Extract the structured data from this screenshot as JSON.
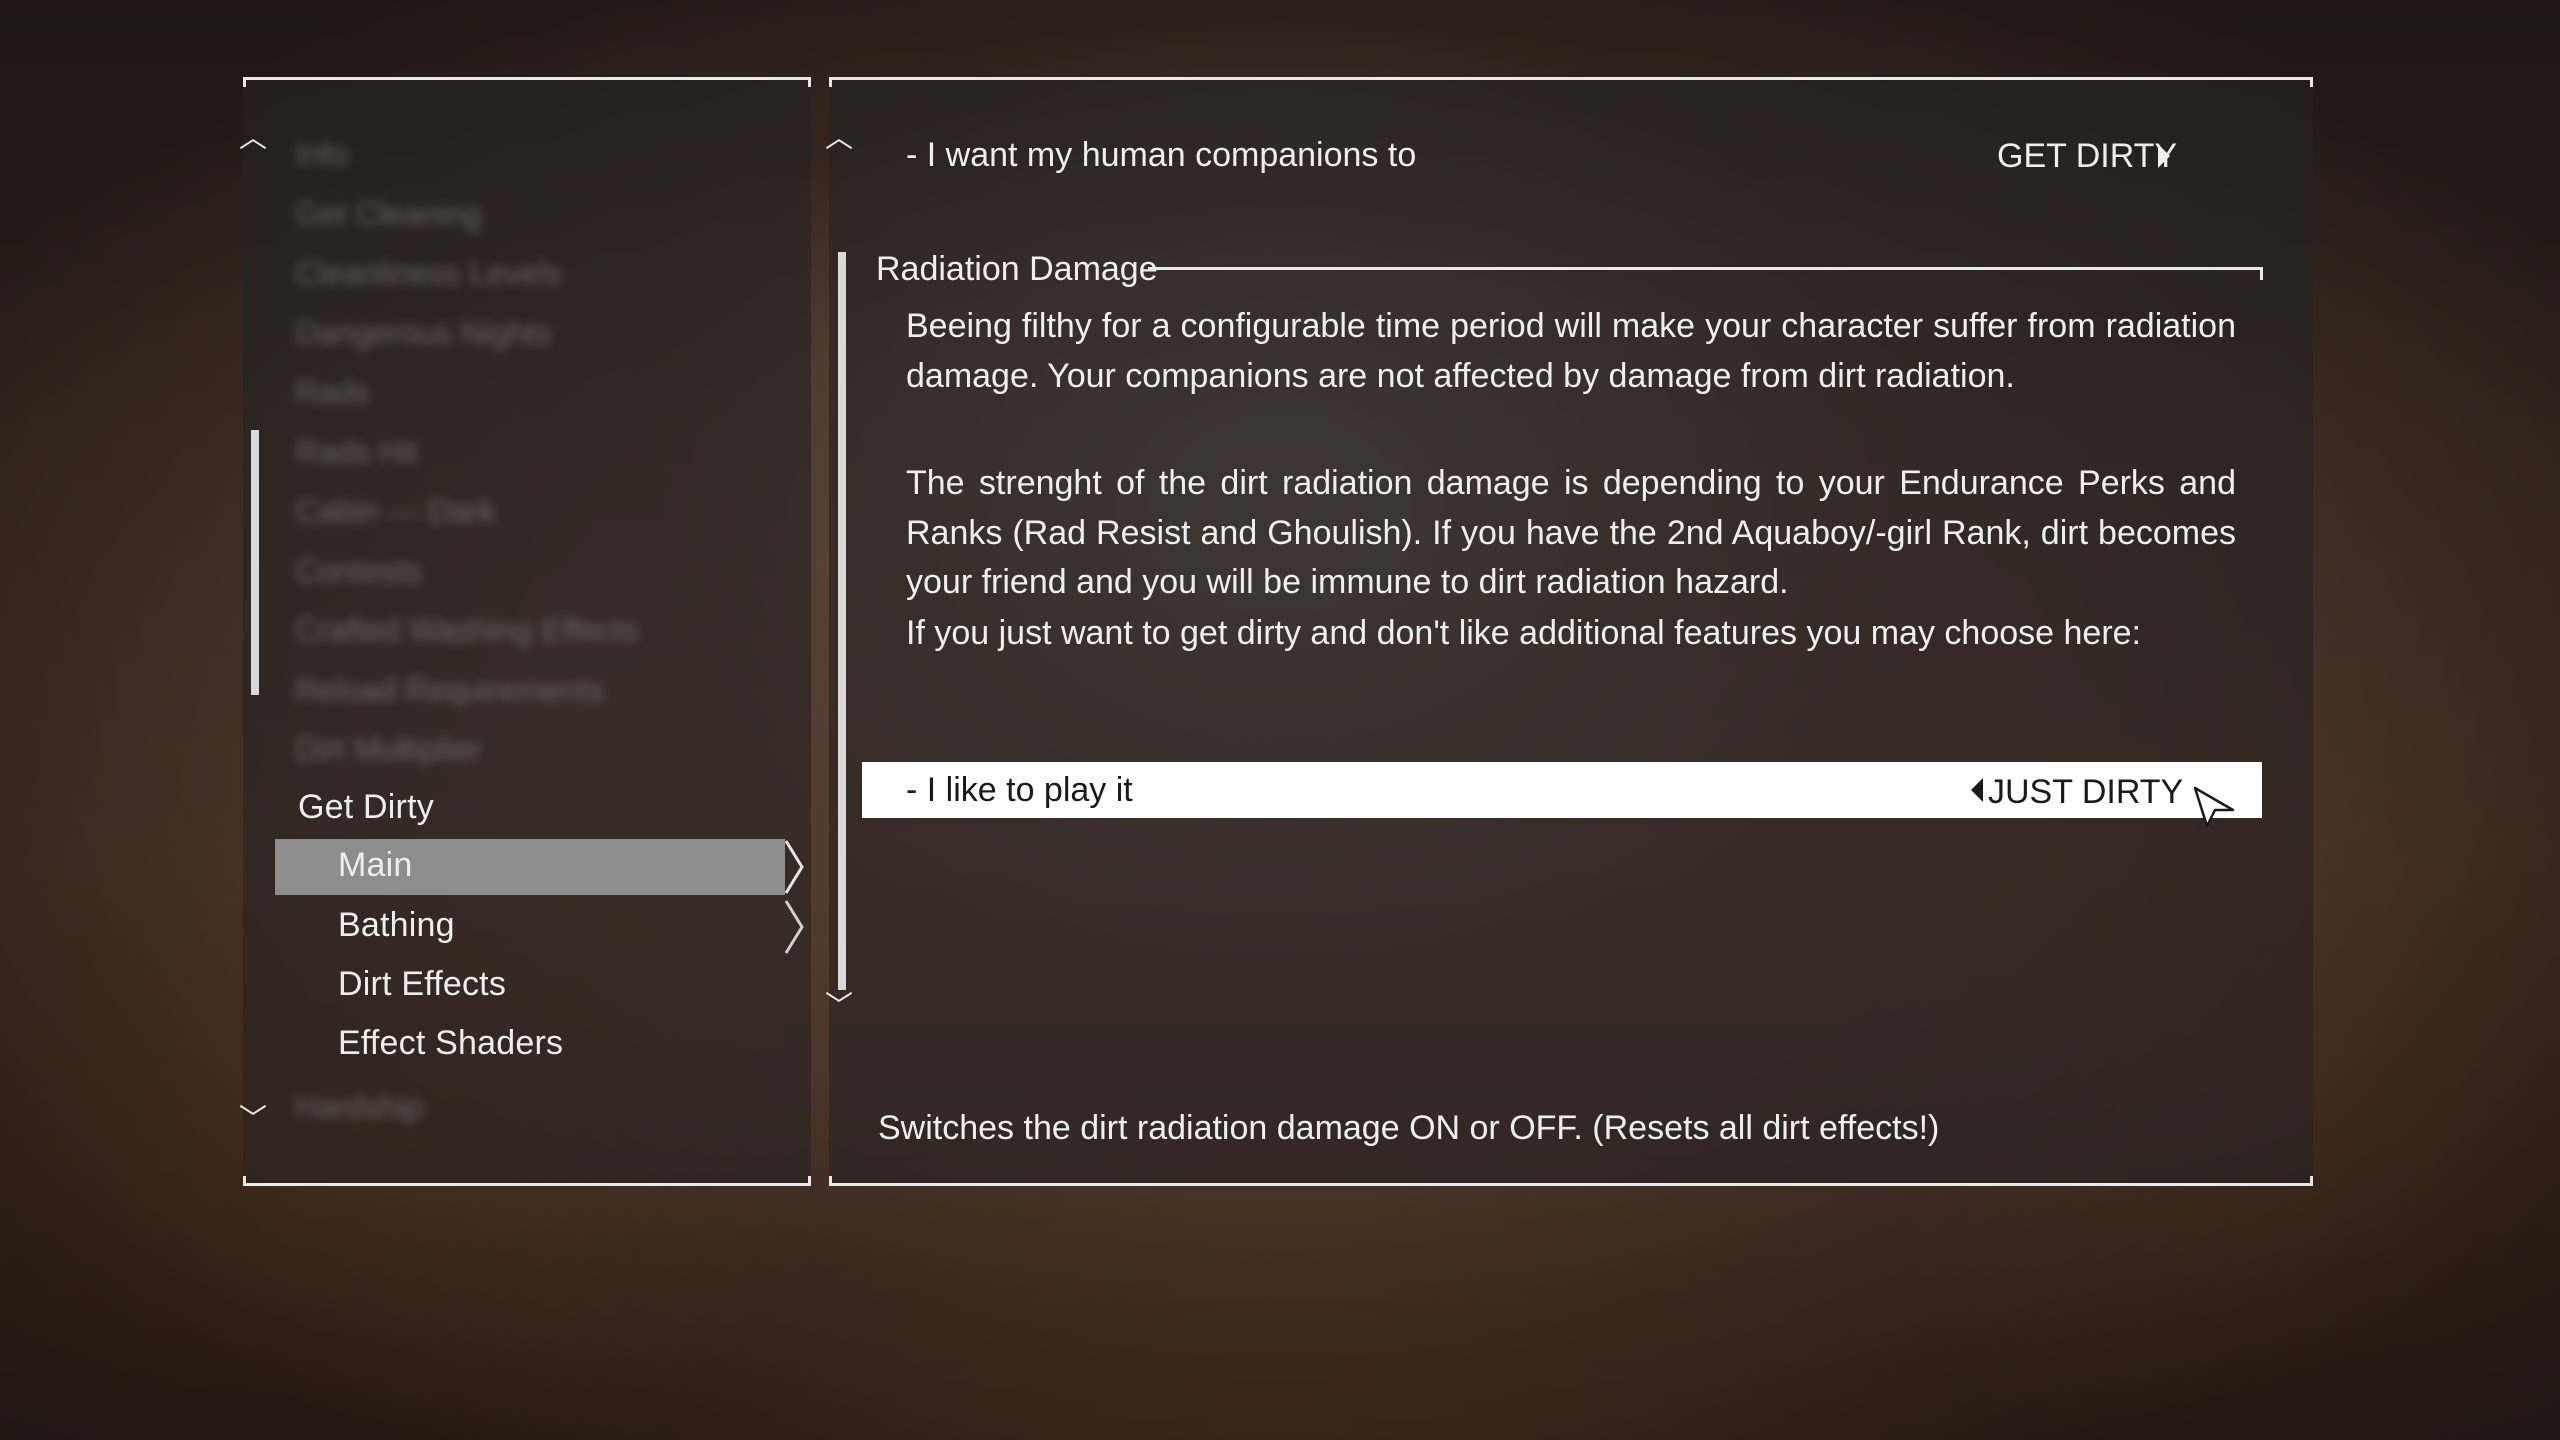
{
  "left_menu": {
    "blurred_items": [
      "Info",
      "Get Cleaning",
      "Cleanliness Levels",
      "Dangerous Nights",
      "Rads",
      "Rads Hit",
      "Cabin — Dark",
      "Contests",
      "Crafted Washing Effects",
      "Reload Requirements",
      "Dirt Multiplier"
    ],
    "blurred_bottom": "Hardship",
    "section": "Get Dirty",
    "items": [
      {
        "label": "Main",
        "selected": true
      },
      {
        "label": "Bathing",
        "selected": false
      },
      {
        "label": "Dirt Effects",
        "selected": false
      },
      {
        "label": "Effect Shaders",
        "selected": false
      }
    ]
  },
  "content": {
    "companions_label": "- I want my human companions to",
    "companions_value": "GET DIRTY",
    "section_title": "Radiation Damage",
    "para1": "Beeing filthy for a configurable time period will make your character suffer from radiation damage. Your companions are not affected by damage from dirt radiation.",
    "para2": "The strenght of the dirt radiation damage is depending to your Endurance Perks and Ranks (Rad Resist and Ghoulish). If you have the 2nd Aquaboy/-girl Rank, dirt becomes your friend and you will be immune to dirt radiation hazard.",
    "para3": "If you just want to get dirty and don't like additional features you may choose here:",
    "play_label": "- I like to play it",
    "play_value": "JUST DIRTY",
    "description": "Switches the dirt radiation damage ON or OFF. (Resets all dirt effects!)"
  },
  "icons": {
    "scroll_up": "chevron-up-icon",
    "scroll_down": "chevron-down-icon",
    "arrow_right": "triangle-right-icon",
    "arrow_left": "triangle-left-icon",
    "cursor": "mouse-cursor-icon"
  },
  "colors": {
    "highlight_bg": "#8d8d8d",
    "selected_row_bg": "#ffffff",
    "panel_line": "#e9e9e9"
  }
}
